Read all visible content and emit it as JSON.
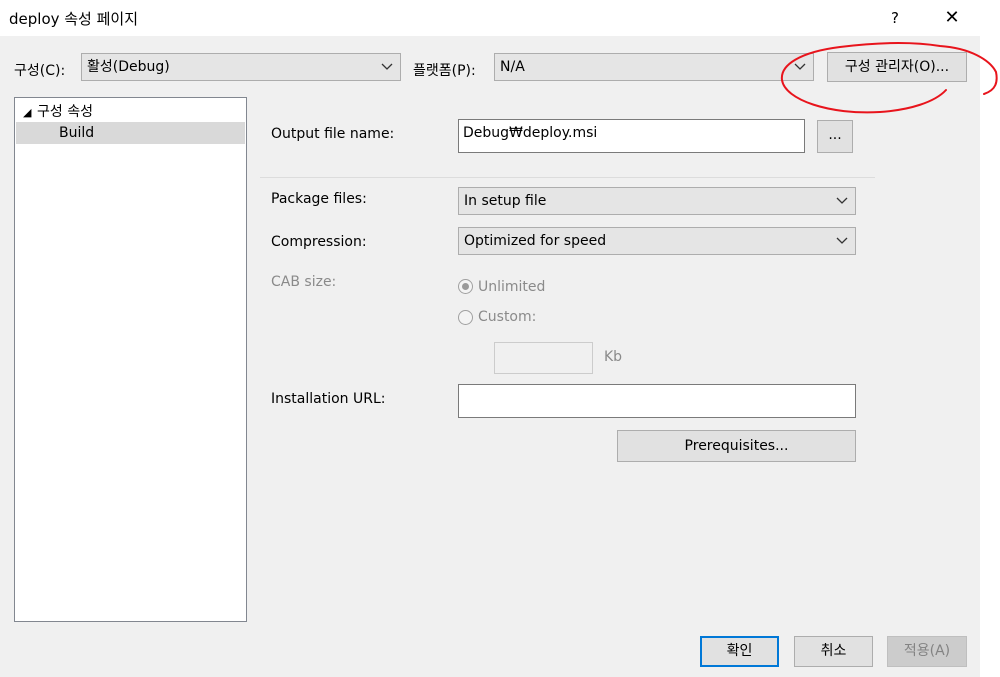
{
  "window": {
    "title": "deploy 속성 페이지",
    "help_label": "?",
    "close_label": "✕"
  },
  "toolbar": {
    "config_label": "구성(C):",
    "config_value": "활성(Debug)",
    "platform_label": "플랫폼(P):",
    "platform_value": "N/A",
    "config_manager_label": "구성 관리자(O)..."
  },
  "tree": {
    "root_label": "구성 속성",
    "child_label": "Build"
  },
  "build": {
    "output_file_label": "Output file name:",
    "output_file_value": "Debug₩deploy.msi",
    "browse_label": "...",
    "package_files_label": "Package files:",
    "package_files_value": "In setup file",
    "compression_label": "Compression:",
    "compression_value": "Optimized for speed",
    "cab_size_label": "CAB size:",
    "unlimited_label": "Unlimited",
    "custom_label": "Custom:",
    "kb_label": "Kb",
    "installation_url_label": "Installation URL:",
    "installation_url_value": "",
    "prerequisites_label": "Prerequisites..."
  },
  "footer": {
    "ok_label": "확인",
    "cancel_label": "취소",
    "apply_label": "적용(A)"
  },
  "colors": {
    "accent": "#0078d7",
    "annotation": "#e8141c",
    "selection": "#d9d9d9"
  },
  "icons": [
    "chevron-down-icon",
    "expand-triangle-icon",
    "close-icon",
    "help-icon"
  ]
}
